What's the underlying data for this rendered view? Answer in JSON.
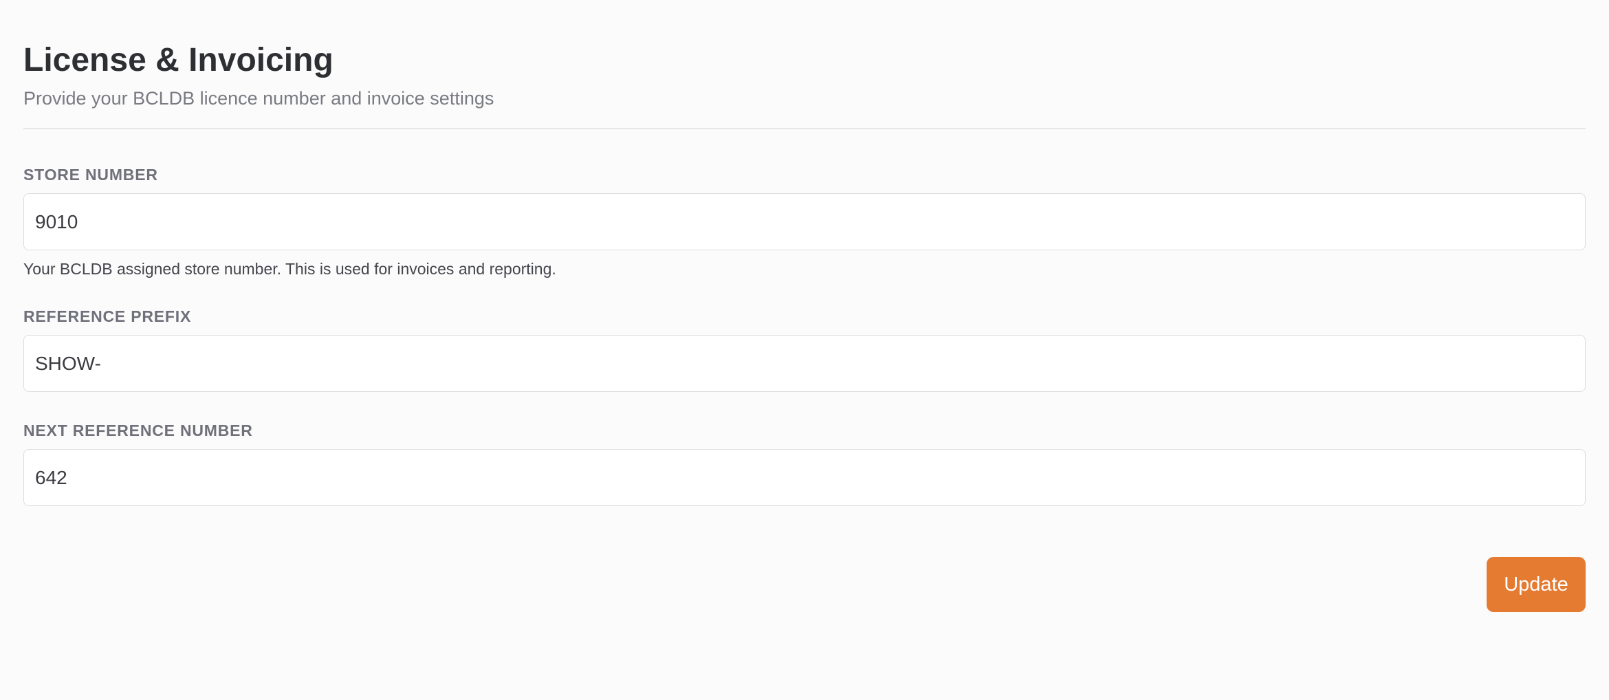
{
  "header": {
    "title": "License & Invoicing",
    "subtitle": "Provide your BCLDB licence number and invoice settings"
  },
  "form": {
    "store_number": {
      "label": "STORE NUMBER",
      "value": "9010",
      "help": "Your BCLDB assigned store number. This is used for invoices and reporting."
    },
    "reference_prefix": {
      "label": "REFERENCE PREFIX",
      "value": "SHOW-"
    },
    "next_reference_number": {
      "label": "NEXT REFERENCE NUMBER",
      "value": "642"
    }
  },
  "actions": {
    "update_label": "Update"
  },
  "colors": {
    "accent": "#e57a31",
    "background": "#fbfbfb",
    "input_border": "#dcdde1"
  }
}
